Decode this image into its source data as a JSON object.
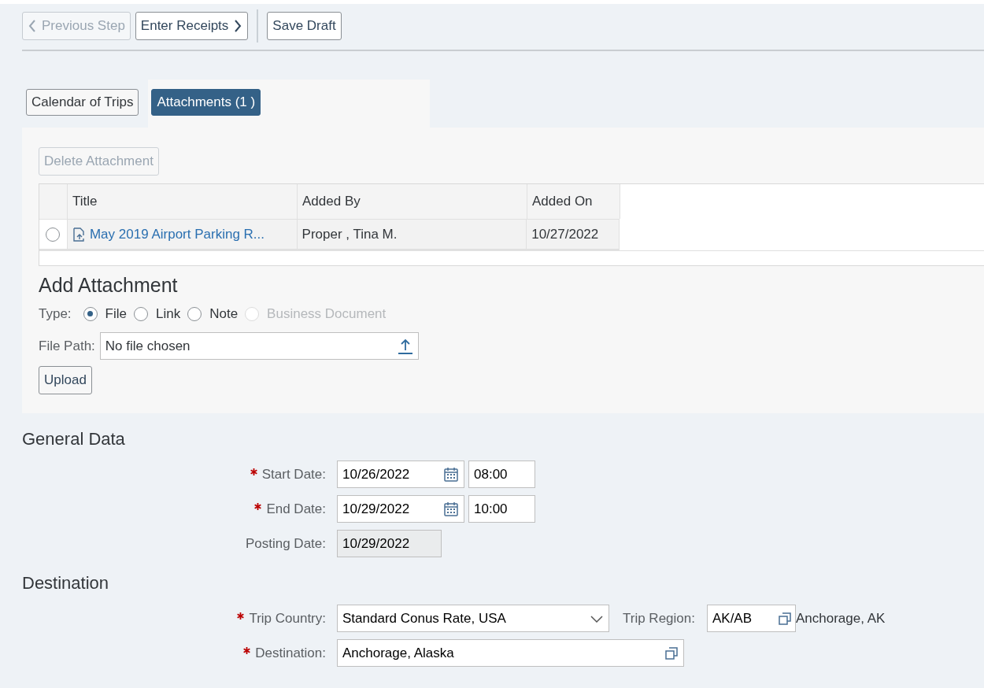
{
  "toolbar": {
    "buttons": [
      {
        "label": "Previous Step",
        "kind": "back",
        "disabled": true
      },
      {
        "label": "Enter Receipts",
        "kind": "forward",
        "disabled": false
      },
      {
        "label": "Save Draft",
        "kind": "plain",
        "disabled": false
      }
    ]
  },
  "tabs": [
    {
      "label": "Calendar of Trips",
      "selected": false
    },
    {
      "label": "Attachments (1 )",
      "selected": true
    }
  ],
  "attachments": {
    "delete_button": {
      "label": "Delete Attachment",
      "disabled": true
    },
    "columns": [
      "Title",
      "Added By",
      "Added On"
    ],
    "rows": [
      {
        "selected": false,
        "title": "May 2019 Airport Parking R...",
        "added_by": "Proper , Tina M.",
        "added_on": "10/27/2022"
      }
    ]
  },
  "add_attachment": {
    "heading": "Add Attachment",
    "type_label": "Type:",
    "options": [
      {
        "label": "File",
        "selected": true,
        "disabled": false
      },
      {
        "label": "Link",
        "selected": false,
        "disabled": false
      },
      {
        "label": "Note",
        "selected": false,
        "disabled": false
      },
      {
        "label": "Business Document",
        "selected": false,
        "disabled": true
      }
    ],
    "file_path": {
      "label": "File Path:",
      "value": "No file chosen"
    },
    "upload_button": "Upload"
  },
  "general_data": {
    "heading": "General Data",
    "fields": [
      {
        "label": "Start Date:",
        "required": true,
        "kind": "datetime",
        "value": "10/26/2022",
        "time": "08:00"
      },
      {
        "label": "End Date:",
        "required": true,
        "kind": "datetime",
        "value": "10/29/2022",
        "time": "10:00"
      },
      {
        "label": "Posting Date:",
        "required": false,
        "kind": "readonly",
        "value": "10/29/2022"
      }
    ]
  },
  "destination": {
    "heading": "Destination",
    "trip_country": {
      "label": "Trip Country:",
      "required": true,
      "value": "Standard Conus Rate, USA"
    },
    "trip_region": {
      "label": "Trip Region:",
      "value": "AK/AB",
      "description": "Anchorage, AK"
    },
    "destination": {
      "label": "Destination:",
      "required": true,
      "value": "Anchorage, Alaska"
    }
  }
}
